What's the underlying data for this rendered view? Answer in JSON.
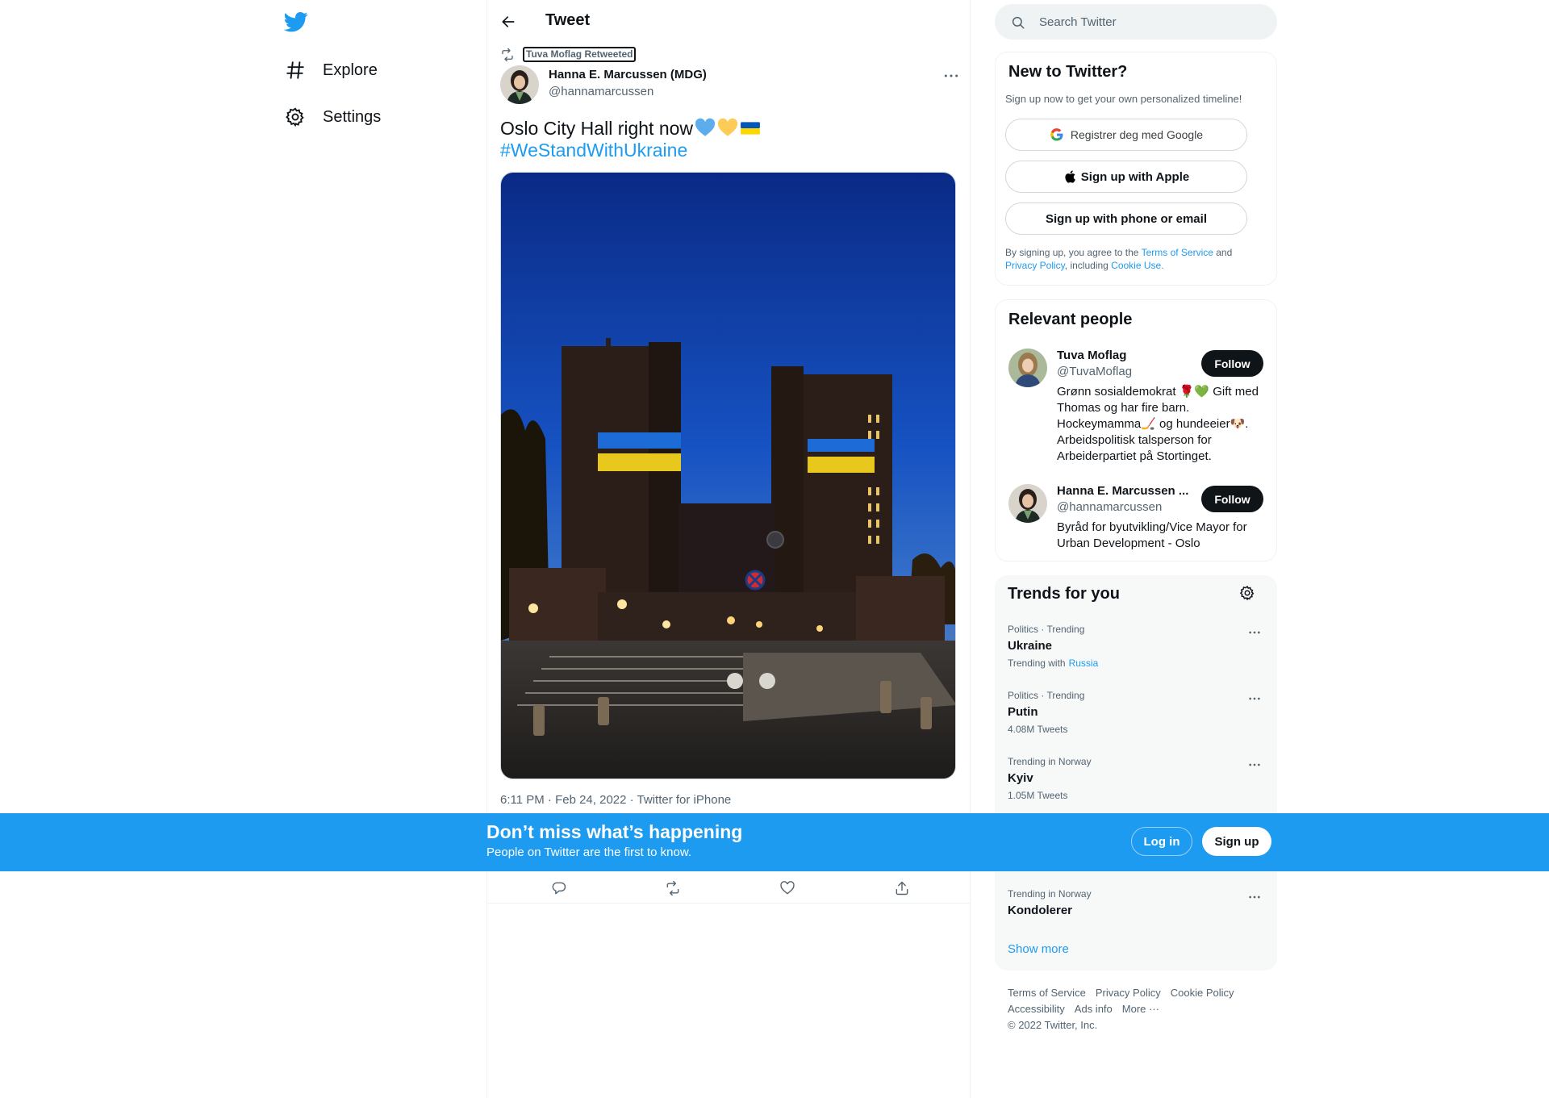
{
  "nav": {
    "logo_icon": "twitter-bird-icon",
    "items": [
      {
        "label": "Explore",
        "icon": "hashtag-icon"
      },
      {
        "label": "Settings",
        "icon": "gear-icon"
      }
    ]
  },
  "header": {
    "title": "Tweet"
  },
  "tweet": {
    "retweeted_by": "Tuva Moflag Retweeted",
    "author_name": "Hanna E. Marcussen (MDG)",
    "author_handle": "@hannamarcussen",
    "text": "Oslo City Hall right now",
    "emojis": [
      "blue-heart",
      "yellow-heart",
      "ukraine-flag"
    ],
    "hashtag": "#WeStandWithUkraine",
    "timestamp": "6:11 PM · Feb 24, 2022",
    "source": "Twitter for iPhone"
  },
  "search": {
    "placeholder": "Search Twitter"
  },
  "new_to_twitter": {
    "title": "New to Twitter?",
    "subtitle": "Sign up now to get your own personalized timeline!",
    "google_label": "Registrer deg med Google",
    "apple_label": "Sign up with Apple",
    "phone_label": "Sign up with phone or email",
    "legal_1": "By signing up, you agree to the ",
    "terms": "Terms of Service",
    "legal_2": " and ",
    "privacy": "Privacy Policy",
    "legal_3": ", including ",
    "cookie": "Cookie Use."
  },
  "relevant": {
    "title": "Relevant people",
    "people": [
      {
        "name": "Tuva Moflag",
        "handle": "@TuvaMoflag",
        "bio": "Grønn sosialdemokrat 🌹💚 Gift med Thomas og har fire barn. Hockeymamma🏒 og hundeeier🐶. Arbeidspolitisk talsperson for Arbeiderpartiet på Stortinget.",
        "follow": "Follow"
      },
      {
        "name": "Hanna E. Marcussen ...",
        "handle": "@hannamarcussen",
        "bio": "Byråd for byutvikling/Vice Mayor for Urban Development - Oslo",
        "follow": "Follow"
      }
    ]
  },
  "trends": {
    "title": "Trends for you",
    "items": [
      {
        "context": "Politics · Trending",
        "name": "Ukraine",
        "sub_prefix": "Trending with",
        "sub_link": "Russia"
      },
      {
        "context": "Politics · Trending",
        "name": "Putin",
        "sub": "4.08M Tweets"
      },
      {
        "context": "Trending in Norway",
        "name": "Kyiv",
        "sub": "1.05M Tweets"
      },
      {
        "context": "Trending in Norway",
        "name": "Kondolerer"
      }
    ],
    "show_more": "Show more"
  },
  "footer": {
    "links": [
      "Terms of Service",
      "Privacy Policy",
      "Cookie Policy",
      "Accessibility",
      "Ads info",
      "More ···"
    ],
    "copyright": "© 2022 Twitter, Inc."
  },
  "banner": {
    "title": "Don’t miss what’s happening",
    "subtitle": "People on Twitter are the first to know.",
    "login": "Log in",
    "signup": "Sign up"
  },
  "colors": {
    "accent": "#1d9bf0",
    "text": "#0f1419",
    "secondary": "#536471"
  }
}
